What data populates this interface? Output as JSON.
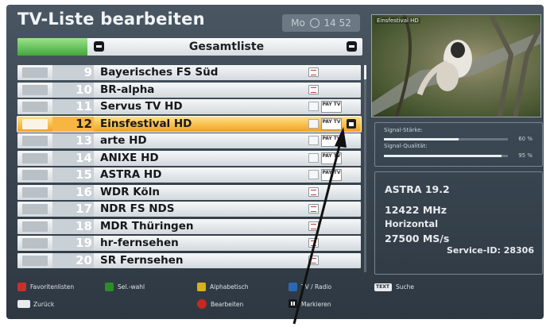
{
  "header": {
    "title": "TV-Liste bearbeiten",
    "day": "Mo",
    "time": "14 52"
  },
  "list_header": {
    "title": "Gesamtliste"
  },
  "channels": [
    {
      "num": "9",
      "name": "Bayerisches FS Süd",
      "selected": false
    },
    {
      "num": "10",
      "name": "BR-alpha",
      "selected": false
    },
    {
      "num": "11",
      "name": "Servus TV HD",
      "selected": false,
      "pay": "PAY TV"
    },
    {
      "num": "12",
      "name": "Einsfestival HD",
      "selected": true,
      "pay": "PAY TV",
      "locked": true
    },
    {
      "num": "13",
      "name": "arte HD",
      "selected": false,
      "pay": "PAY TV"
    },
    {
      "num": "14",
      "name": "ANIXE HD",
      "selected": false,
      "pay": "PAY TV"
    },
    {
      "num": "15",
      "name": "ASTRA HD",
      "selected": false,
      "pay": "PAY TV"
    },
    {
      "num": "16",
      "name": "WDR Köln",
      "selected": false
    },
    {
      "num": "17",
      "name": "NDR FS NDS",
      "selected": false
    },
    {
      "num": "18",
      "name": "MDR Thüringen",
      "selected": false
    },
    {
      "num": "19",
      "name": "hr-fernsehen",
      "selected": false
    },
    {
      "num": "20",
      "name": "SR Fernsehen",
      "selected": false
    }
  ],
  "preview": {
    "label": "Einsfestival HD"
  },
  "signal": {
    "strength_label": "Signal-Stärke:",
    "strength_pct": "60 %",
    "strength_value": 0.6,
    "quality_label": "Signal-Qualität:",
    "quality_pct": "95 %",
    "quality_value": 0.95
  },
  "info": {
    "satellite": "ASTRA 19.2",
    "frequency": "12422 MHz",
    "polarization": "Horizontal",
    "symbol_rate": "27500 MS/s",
    "service_id": "Service-ID: 28306"
  },
  "keys": {
    "red": "Favoritenlisten",
    "green": "Sel.-wahl",
    "yellow": "Alphabetisch",
    "blue": "TV / Radio",
    "text_key": "TEXT",
    "text": "Suche",
    "back": "Zurück",
    "ok": "Bearbeiten",
    "mark": "Markieren"
  },
  "colors": {
    "selected_row": "#f2a11c",
    "key_red": "#c8302a",
    "key_green": "#2f8a2a",
    "key_yellow": "#d7b21d",
    "key_blue": "#2a69b1"
  }
}
